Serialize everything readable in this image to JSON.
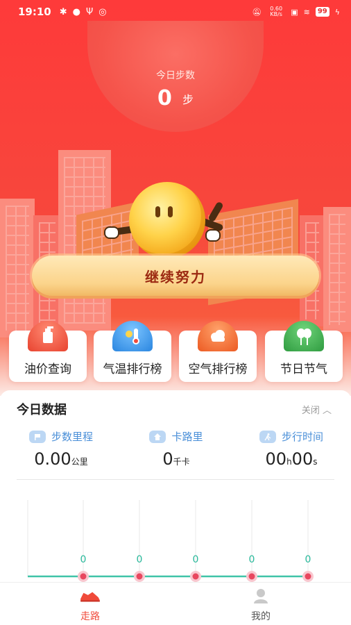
{
  "status_bar": {
    "time": "19:10",
    "battery": "99",
    "net_speed": "0.60 KB/s"
  },
  "steps": {
    "title": "今日步数",
    "count": "0",
    "unit": "步"
  },
  "continue_button": "继续努力",
  "features": [
    {
      "label": "油价查询",
      "icon": "oil-can-icon",
      "color": "#f0523f"
    },
    {
      "label": "气温排行榜",
      "icon": "thermometer-icon",
      "color": "#3c9be8"
    },
    {
      "label": "空气排行榜",
      "icon": "cloud-icon",
      "color": "#f26a2e"
    },
    {
      "label": "节日节气",
      "icon": "balloon-icon",
      "color": "#3aaa4a"
    }
  ],
  "today_data": {
    "title": "今日数据",
    "toggle": "关闭",
    "stats": [
      {
        "label": "步数里程",
        "value": "0.00",
        "unit": "公里",
        "icon": "flag-icon"
      },
      {
        "label": "卡路里",
        "value": "0",
        "unit": "千卡",
        "icon": "home-icon"
      },
      {
        "label": "步行时间",
        "value_h": "00",
        "h": "h",
        "value_s": "00",
        "s": "s",
        "icon": "runner-icon"
      }
    ]
  },
  "chart_data": {
    "type": "line",
    "x": [
      "",
      "",
      "",
      "",
      ""
    ],
    "series": [
      {
        "values": [
          0,
          0,
          0,
          0,
          0
        ]
      }
    ],
    "data_labels": [
      "0",
      "0",
      "0",
      "0",
      "0"
    ],
    "ylim": [
      0,
      1
    ],
    "grid": true,
    "colors": {
      "line": "#3fc4a8",
      "point": "#e8475f"
    }
  },
  "nav": {
    "items": [
      {
        "label": "走路",
        "icon": "sneaker-icon",
        "active": true
      },
      {
        "label": "我的",
        "icon": "user-icon",
        "active": false
      }
    ],
    "active_color": "#f04a3a",
    "inactive_color": "#555555"
  }
}
